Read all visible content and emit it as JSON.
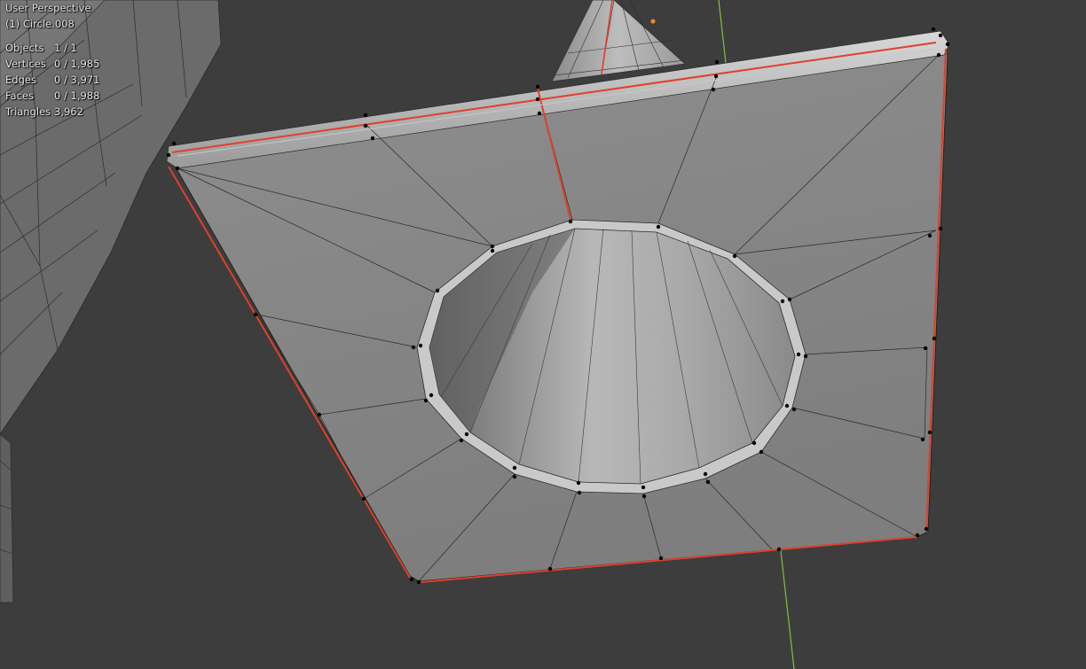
{
  "viewport": {
    "view_name": "User Perspective",
    "object_name": "(1) Circle.008"
  },
  "statistics": {
    "rows": [
      {
        "label": "Objects",
        "value": "1 / 1"
      },
      {
        "label": "Vertices",
        "value": "0 / 1,985"
      },
      {
        "label": "Edges",
        "value": "0 / 3,971"
      },
      {
        "label": "Faces",
        "value": "0 / 1,988"
      },
      {
        "label": "Triangles",
        "value": "3,962"
      }
    ]
  },
  "colors": {
    "background": "#3d3d3d",
    "mesh_face": "#9a9a9a",
    "seam_edge": "#e0402a",
    "y_axis": "#7fbf3f",
    "vertex": "#000000",
    "object_origin": "#f08a2c"
  }
}
